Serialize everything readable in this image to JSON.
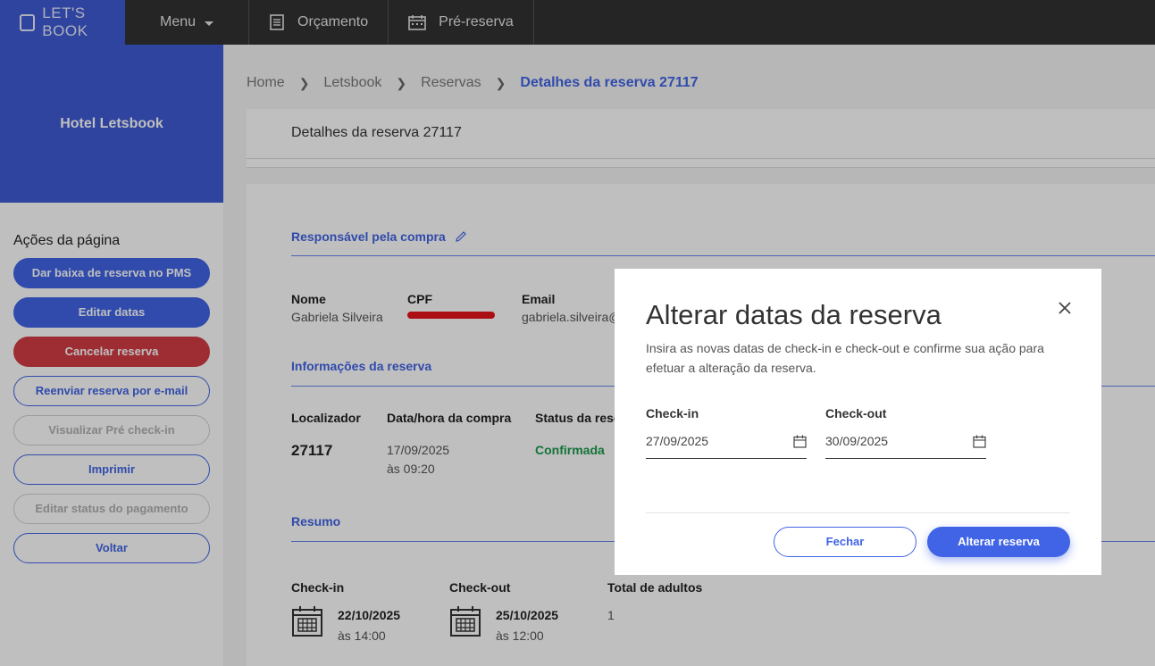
{
  "topbar": {
    "brand": "LET'S BOOK",
    "menu_label": "Menu",
    "nav": [
      "Orçamento",
      "Pré-reserva"
    ]
  },
  "sidebar": {
    "hotel_name": "Hotel Letsbook",
    "actions_title": "Ações da página",
    "actions": [
      "Dar baixa de reserva no PMS",
      "Editar datas",
      "Cancelar reserva",
      "Reenviar reserva por e-mail",
      "Visualizar Pré check-in",
      "Imprimir",
      "Editar status do pagamento",
      "Voltar"
    ]
  },
  "breadcrumb": [
    "Home",
    "Letsbook",
    "Reservas",
    "Detalhes da reserva 27117"
  ],
  "page_title": "Detalhes da reserva 27117",
  "buyer": {
    "section_title": "Responsável pela compra",
    "name_label": "Nome",
    "name_value": "Gabriela Silveira",
    "cpf_label": "CPF",
    "email_label": "Email",
    "email_value": "gabriela.silveira@"
  },
  "reservation": {
    "section_title": "Informações da reserva",
    "locator_label": "Localizador",
    "locator_value": "27117",
    "purchase_label": "Data/hora da compra",
    "purchase_date": "17/09/2025",
    "purchase_time": "às 09:20",
    "status_label": "Status da rese",
    "status_value": "Confirmada"
  },
  "summary": {
    "section_title": "Resumo",
    "checkin_label": "Check-in",
    "checkin_date": "22/10/2025",
    "checkin_time": "às 14:00",
    "checkout_label": "Check-out",
    "checkout_date": "25/10/2025",
    "checkout_time": "às 12:00",
    "adults_label": "Total de adultos",
    "adults_value": "1"
  },
  "modal": {
    "title": "Alterar datas da reserva",
    "description": "Insira as novas datas de check-in e check-out e confirme sua ação para efetuar a alteração da reserva.",
    "checkin_label": "Check-in",
    "checkin_value": "27/09/2025",
    "checkout_label": "Check-out",
    "checkout_value": "30/09/2025",
    "close_label": "Fechar",
    "confirm_label": "Alterar reserva"
  },
  "colors": {
    "primary": "#4164e6",
    "danger": "#d23c45",
    "success": "#1a9b4b",
    "topbar": "#323232"
  }
}
